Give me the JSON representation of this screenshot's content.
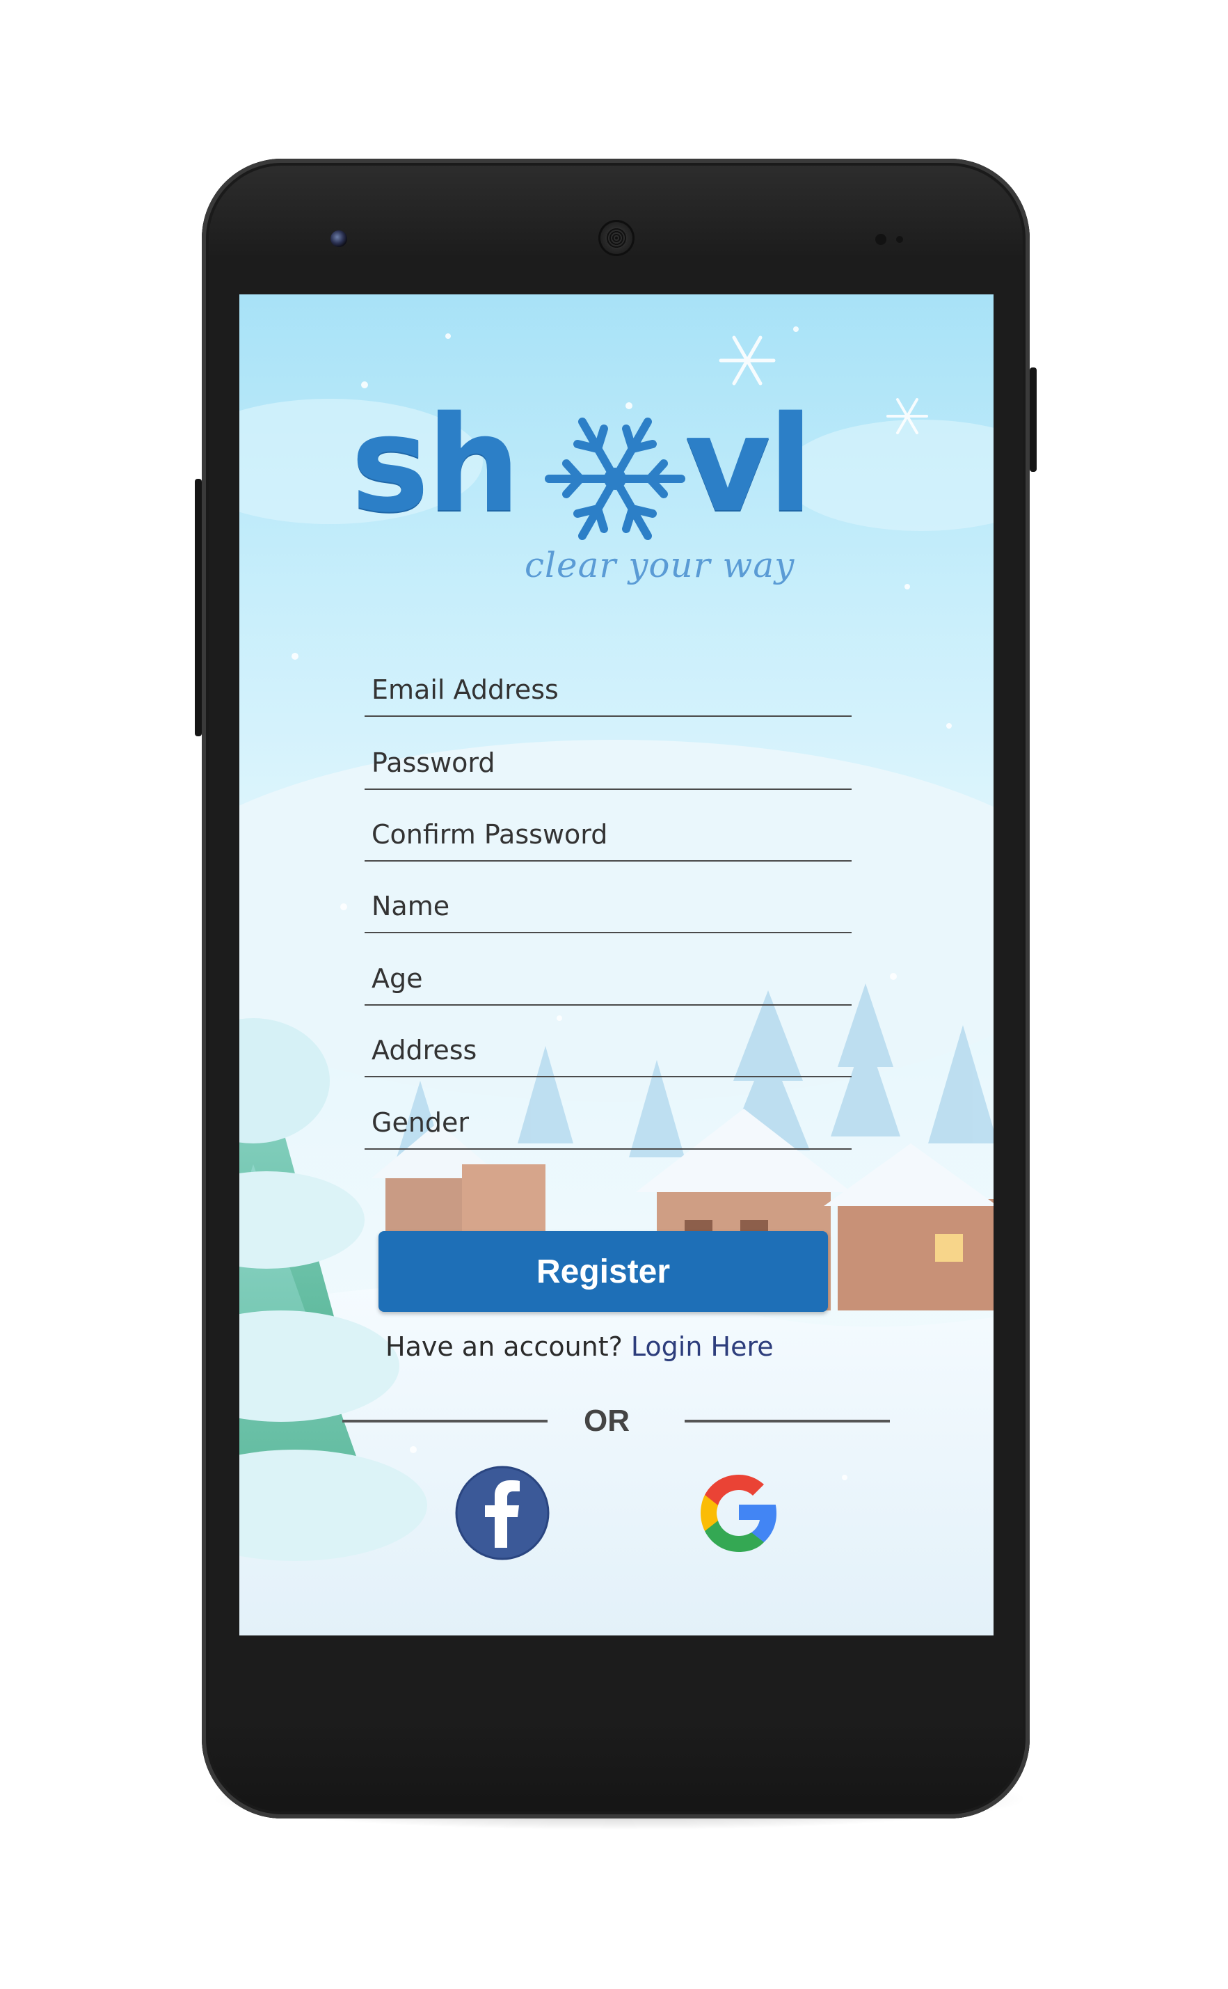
{
  "app": {
    "logo_text_left": "sh",
    "logo_text_right": "vl",
    "tagline": "clear your way"
  },
  "form": {
    "email_placeholder": "Email Address",
    "password_placeholder": "Password",
    "confirm_password_placeholder": "Confirm Password",
    "name_placeholder": "Name",
    "age_placeholder": "Age",
    "address_placeholder": "Address",
    "gender_placeholder": "Gender"
  },
  "actions": {
    "register_label": "Register",
    "have_account_text": "Have an account? ",
    "login_link_text": "Login Here",
    "or_text": "OR"
  },
  "social": {
    "facebook_icon": "facebook-icon",
    "google_icon": "google-icon"
  },
  "colors": {
    "brand_blue": "#2c7fc7",
    "button_blue": "#1e6fb7",
    "facebook_blue": "#3b5998"
  }
}
